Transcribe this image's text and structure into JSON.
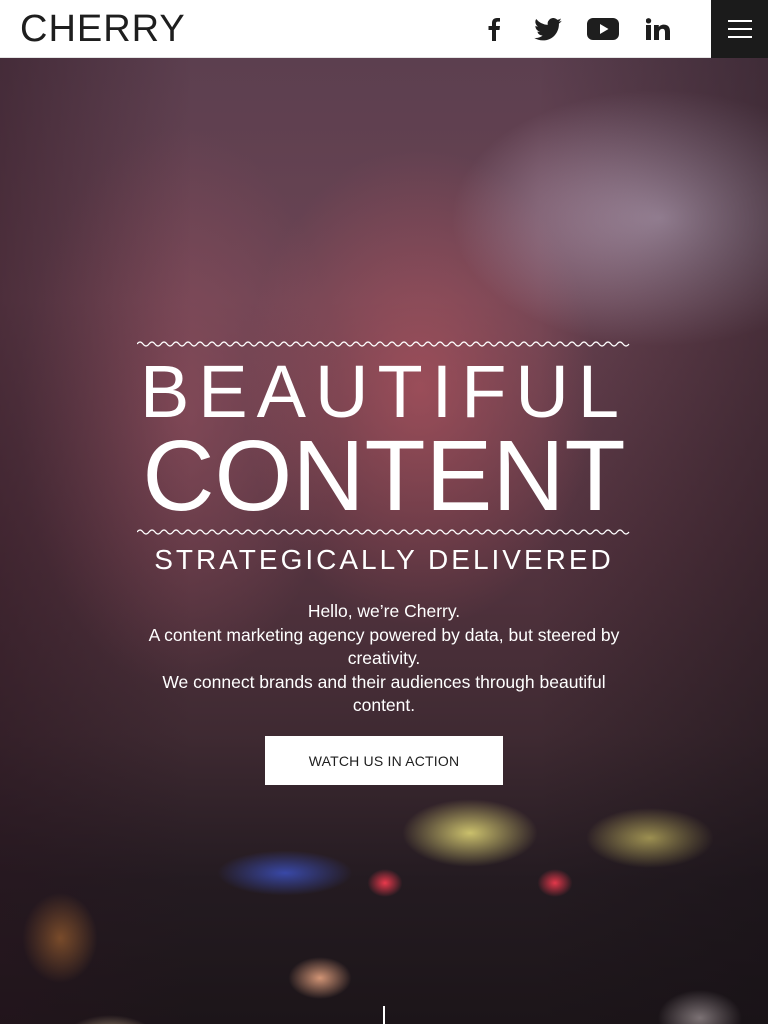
{
  "header": {
    "logo": "CHERRY",
    "social": [
      {
        "name": "facebook-icon"
      },
      {
        "name": "twitter-icon"
      },
      {
        "name": "youtube-icon"
      },
      {
        "name": "linkedin-icon"
      }
    ],
    "menu_icon": "hamburger-menu-icon"
  },
  "hero": {
    "headline_line1": "BEAUTIFUL",
    "headline_line2": "CONTENT",
    "subheadline": "STRATEGICALLY DELIVERED",
    "intro": [
      "Hello, we’re Cherry.",
      "A content marketing agency powered by data, but steered by creativity.",
      "We connect brands and their audiences through beautiful content."
    ],
    "cta_label": "WATCH US IN ACTION",
    "scroll_icon": "arrow-down-icon"
  },
  "colors": {
    "header_bg": "#ffffff",
    "menu_bg": "#1b1b1b",
    "text_dark": "#1e1e1e",
    "hero_text": "#ffffff"
  }
}
